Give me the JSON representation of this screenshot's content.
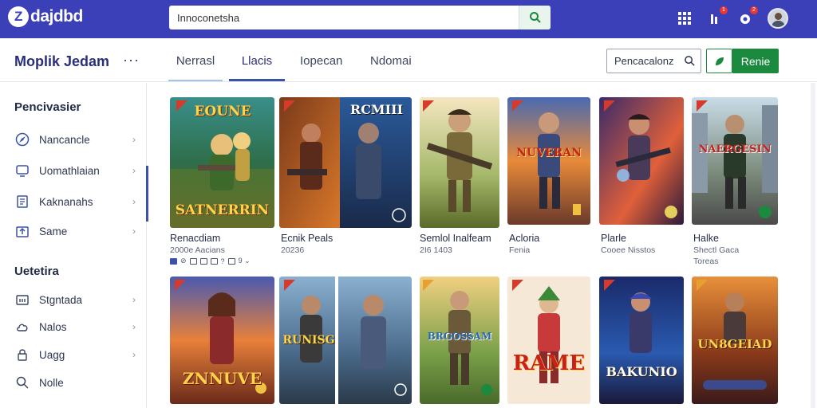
{
  "header": {
    "logo_mark": "Z",
    "logo_text": "dajdbd",
    "search": {
      "value": "Innoconetsha",
      "placeholder": ""
    },
    "icons": [
      "grid-icon",
      "bell-icon",
      "notification-icon"
    ],
    "badges": [
      "1",
      "2"
    ]
  },
  "subheader": {
    "title": "Moplik Jedam",
    "more": "···",
    "tabs": [
      {
        "label": "Nerrasl"
      },
      {
        "label": "Llacis"
      },
      {
        "label": "Iopecan"
      },
      {
        "label": "Ndomai"
      }
    ],
    "search_label": "Pencacalonz",
    "primary_button": "Renie"
  },
  "sidebar": {
    "heading1": "Pencivasier",
    "items1": [
      {
        "label": "Nancancle",
        "icon": "compass-icon"
      },
      {
        "label": "Uomathlaian",
        "icon": "monitor-icon"
      },
      {
        "label": "Kaknanahs",
        "icon": "document-icon"
      },
      {
        "label": "Same",
        "icon": "upload-icon"
      }
    ],
    "heading2": "Uetetira",
    "items2": [
      {
        "label": "Stgntada",
        "icon": "folder-icon"
      },
      {
        "label": "Nalos",
        "icon": "cloud-icon"
      },
      {
        "label": "Uagg",
        "icon": "lock-icon"
      },
      {
        "label": "Nolle",
        "icon": "search-icon"
      }
    ]
  },
  "cards_row1": [
    {
      "art_top": "EOUNE",
      "art_bottom": "SATNERRIN",
      "title": "Renacdiam",
      "meta": "2000e Aacians",
      "meta2": ""
    },
    {
      "art_top": "RCMIII",
      "art_bottom": "",
      "title": "Ecnik Peals",
      "meta": "20236",
      "meta2": ""
    },
    {
      "art_top": "",
      "art_bottom": "",
      "title": "Semlol Inalfeam",
      "meta": "2I6 1403",
      "meta2": ""
    },
    {
      "art_top": "NUVERAN",
      "art_bottom": "",
      "title": "Acloria",
      "meta": "Fenia",
      "meta2": ""
    },
    {
      "art_top": "",
      "art_bottom": "",
      "title": "Plarle",
      "meta": "Cooee Nisstos",
      "meta2": ""
    },
    {
      "art_top": "NAERGESIN",
      "art_bottom": "",
      "title": "Halke",
      "meta": "Shectl Gaca",
      "meta2": "Toreas"
    }
  ],
  "cards_row2": [
    {
      "art_top": "",
      "art_bottom": "ZNNUVE"
    },
    {
      "art_top": "",
      "art_bottom": "RUNISG"
    },
    {
      "art_top": "",
      "art_bottom": "BRGOSSAM"
    },
    {
      "art_top": "",
      "art_bottom": "RAME"
    },
    {
      "art_top": "",
      "art_bottom": "BAKUNIO"
    },
    {
      "art_top": "",
      "art_bottom": "UN8GEIAD"
    }
  ],
  "card_tiny_icons": "9 ⌄",
  "colors": {
    "topbar": "#3b40b8",
    "accent": "#3b52a8",
    "green": "#1b8a3e"
  }
}
